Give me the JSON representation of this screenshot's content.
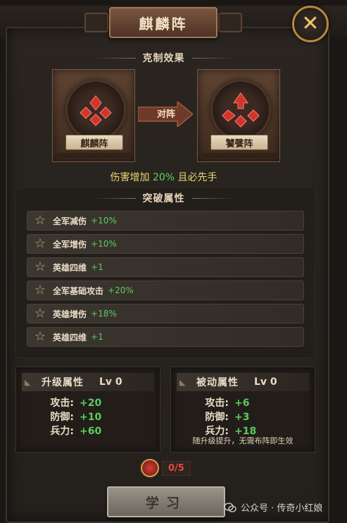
{
  "title": "麒麟阵",
  "close_icon": "close-icon",
  "counter_section": {
    "header": "克制效果",
    "left_formation": "麒麟阵",
    "vs_label": "对阵",
    "right_formation": "饕餮阵",
    "effect": {
      "prefix": "伤害增加 ",
      "percent": "20%",
      "suffix": " 且必先手"
    }
  },
  "breakthrough_section": {
    "header": "突破属性",
    "rows": [
      {
        "name": "全军减伤",
        "value": "+10%"
      },
      {
        "name": "全军增伤",
        "value": "+10%"
      },
      {
        "name": "英雄四维",
        "value": "+1"
      },
      {
        "name": "全军基础攻击",
        "value": "+20%"
      },
      {
        "name": "英雄增伤",
        "value": "+18%"
      },
      {
        "name": "英雄四维",
        "value": "+1"
      }
    ]
  },
  "upgrade_panel": {
    "title": "升级属性",
    "level": "Lv 0",
    "stats": [
      {
        "label": "攻击:",
        "value": "+20"
      },
      {
        "label": "防御:",
        "value": "+10"
      },
      {
        "label": "兵力:",
        "value": "+60"
      }
    ]
  },
  "passive_panel": {
    "title": "被动属性",
    "level": "Lv 0",
    "stats": [
      {
        "label": "攻击:",
        "value": "+6"
      },
      {
        "label": "防御:",
        "value": "+3"
      },
      {
        "label": "兵力:",
        "value": "+18"
      }
    ],
    "note": "随升级提升，无需布阵即生效"
  },
  "cost": {
    "count": "0/5"
  },
  "learn_button": "学习",
  "watermark": "公众号 · 传奇小红娘",
  "colors": {
    "accent_gold": "#efd770",
    "bonus_green": "#5ccc5c",
    "cost_red": "#e84a3a"
  }
}
